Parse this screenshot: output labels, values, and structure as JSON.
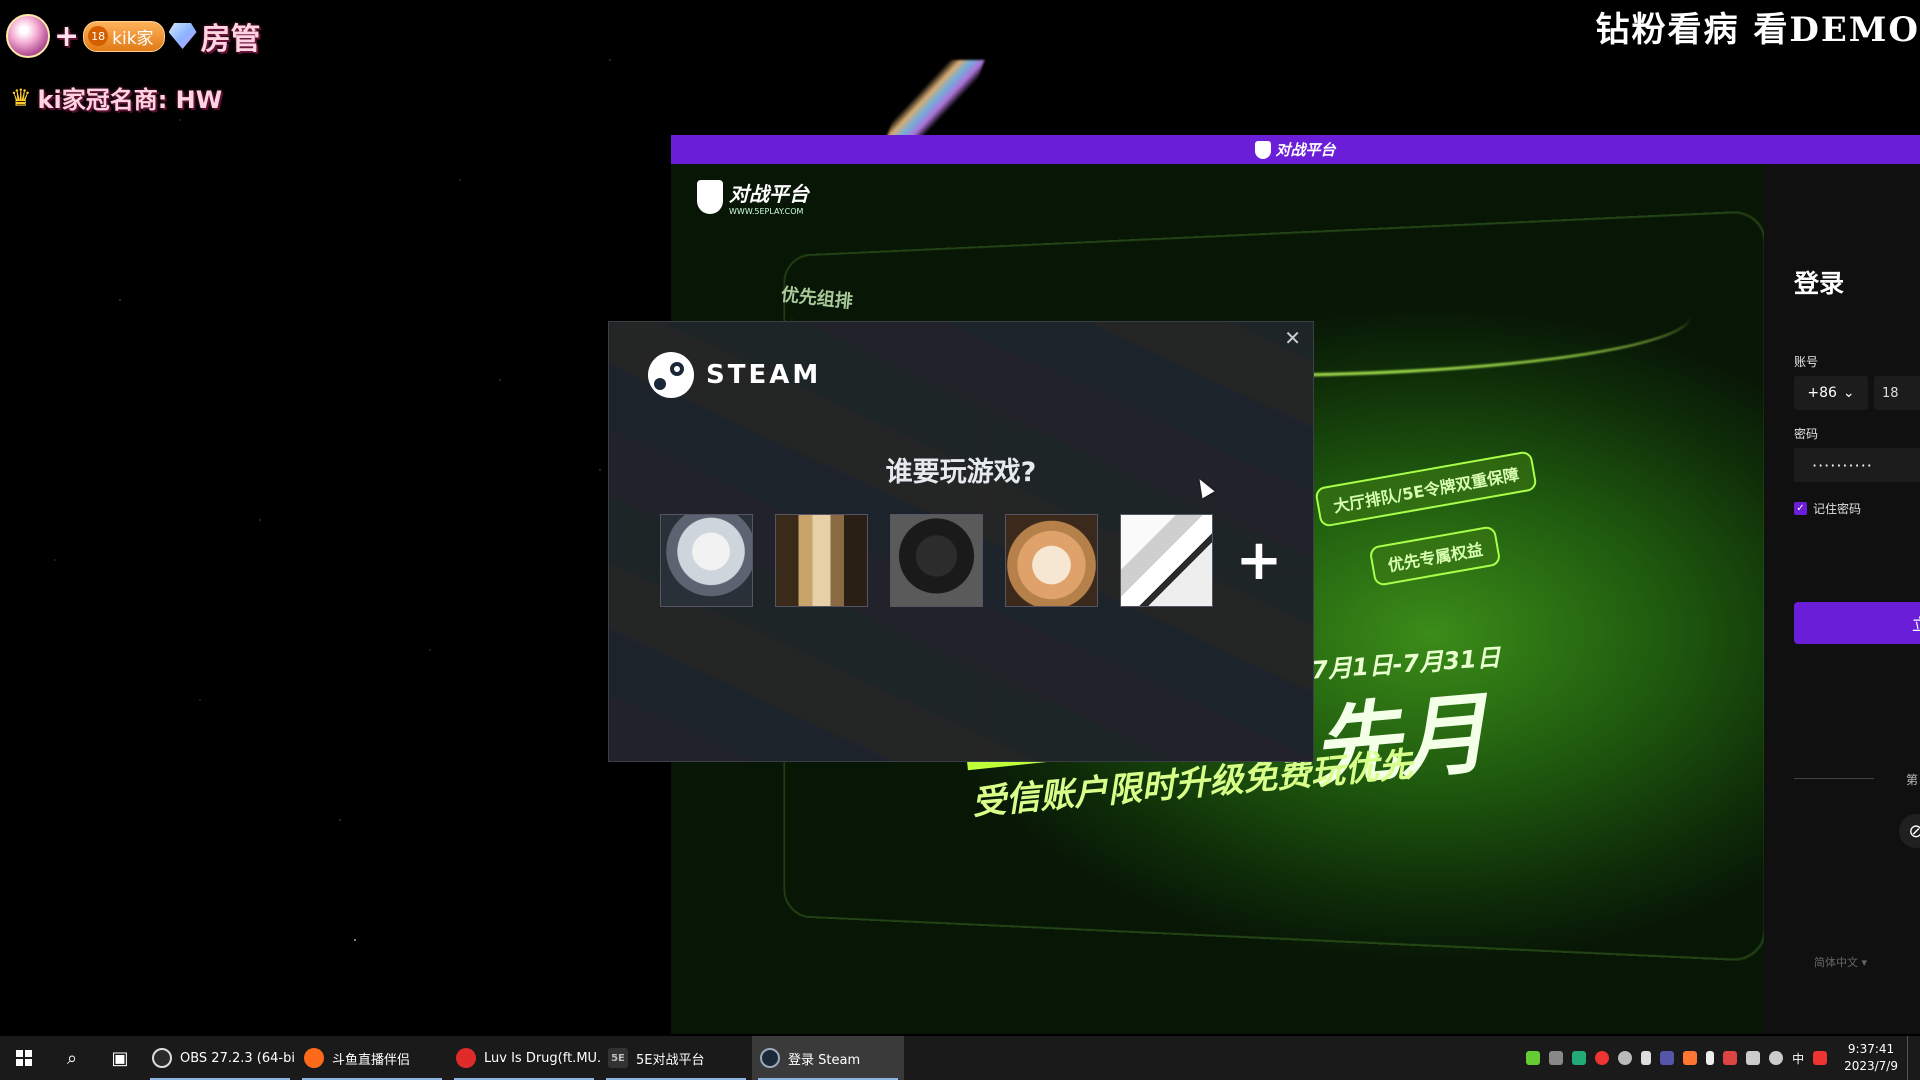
{
  "overlay": {
    "badge_plus": "+",
    "badge_kik_num": "18",
    "badge_kik_text": "kik家",
    "badge_role": "房管",
    "crown_text": "ki家冠名商: HW",
    "stream_title": "钻粉看病 看DEMO"
  },
  "window_5e": {
    "titlebar_brand": "对战平台",
    "logo_brand": "对战平台",
    "logo_sub": "WWW.5EPLAY.COM",
    "banner": {
      "priority_label": "优先组排",
      "tag1": "大厅排队/5E令牌双重保障",
      "tag2": "优先专属权益",
      "date_range": "7月1日-7月31日",
      "big_text": "先月",
      "slogan": "受信账户限时升级免费玩优先"
    },
    "login": {
      "title": "登录",
      "account_label": "账号",
      "country_code": "+86",
      "phone_value": "18",
      "password_label": "密码",
      "password_mask": "··········",
      "remember_label": "记住密码",
      "login_button": "立",
      "third_party_label": "第",
      "language": "简体中文"
    }
  },
  "steam": {
    "brand": "STEAM",
    "question": "谁要玩游戏?",
    "close_glyph": "✕",
    "add_glyph": "+",
    "account_count": 5
  },
  "taskbar": {
    "apps": [
      {
        "label": "OBS 27.2.3 (64-bi...",
        "icon": "obs-icon",
        "state": "running"
      },
      {
        "label": "斗鱼直播伴侣",
        "icon": "douyu-icon",
        "state": "running"
      },
      {
        "label": "Luv Is Drug(ft.MU...",
        "icon": "netease-music-icon",
        "state": "running"
      },
      {
        "label": "5E对战平台",
        "icon": "5e-icon",
        "state": "running"
      },
      {
        "label": "登录 Steam",
        "icon": "steam-icon",
        "state": "active"
      }
    ],
    "ime": "中",
    "time": "9:37:41",
    "date": "2023/7/9"
  }
}
